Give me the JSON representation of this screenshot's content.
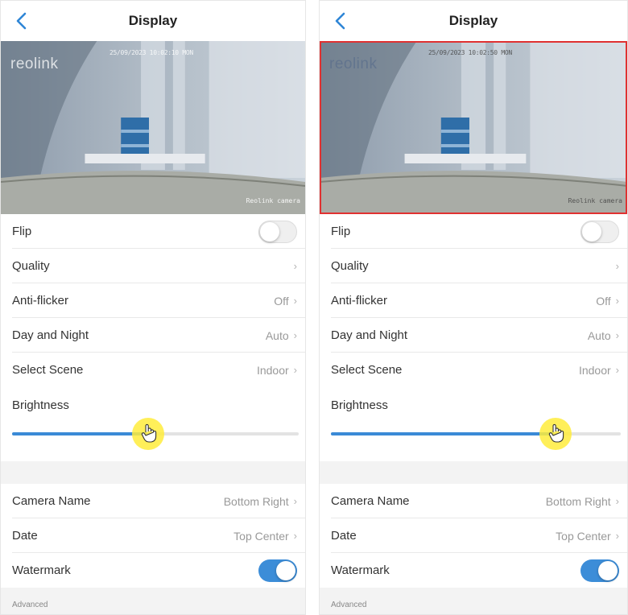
{
  "screens": [
    {
      "title": "Display",
      "preview": {
        "watermark": "reolink",
        "timestamp": "25/09/2023 10:02:10 MON",
        "camera_label": "Reolink camera",
        "selected": false
      },
      "rows": [
        {
          "label": "Flip",
          "type": "toggle",
          "on": false
        },
        {
          "label": "Quality",
          "type": "nav",
          "value": ""
        },
        {
          "label": "Anti-flicker",
          "type": "nav",
          "value": "Off"
        },
        {
          "label": "Day and Night",
          "type": "nav",
          "value": "Auto"
        },
        {
          "label": "Select Scene",
          "type": "nav",
          "value": "Indoor"
        }
      ],
      "brightness": {
        "label": "Brightness",
        "level": 0.47
      },
      "rows2": [
        {
          "label": "Camera Name",
          "type": "nav",
          "value": "Bottom Right"
        },
        {
          "label": "Date",
          "type": "nav",
          "value": "Top Center"
        },
        {
          "label": "Watermark",
          "type": "toggle",
          "on": true
        }
      ],
      "advanced": "Advanced"
    },
    {
      "title": "Display",
      "preview": {
        "watermark": "reolink",
        "timestamp": "25/09/2023 10:02:50 MON",
        "camera_label": "Reolink camera",
        "selected": true
      },
      "rows": [
        {
          "label": "Flip",
          "type": "toggle",
          "on": false
        },
        {
          "label": "Quality",
          "type": "nav",
          "value": ""
        },
        {
          "label": "Anti-flicker",
          "type": "nav",
          "value": "Off"
        },
        {
          "label": "Day and Night",
          "type": "nav",
          "value": "Auto"
        },
        {
          "label": "Select Scene",
          "type": "nav",
          "value": "Indoor"
        }
      ],
      "brightness": {
        "label": "Brightness",
        "level": 0.77
      },
      "rows2": [
        {
          "label": "Camera Name",
          "type": "nav",
          "value": "Bottom Right"
        },
        {
          "label": "Date",
          "type": "nav",
          "value": "Top Center"
        },
        {
          "label": "Watermark",
          "type": "toggle",
          "on": true
        }
      ],
      "advanced": "Advanced"
    }
  ],
  "colors": {
    "accent": "#3a8ad6",
    "selection_border": "#e03131",
    "cursor_highlight": "#ffec3c"
  },
  "icons": {
    "back": "chevron-left-icon",
    "chevron": "chevron-right-icon",
    "pointer": "hand-pointer-icon"
  }
}
